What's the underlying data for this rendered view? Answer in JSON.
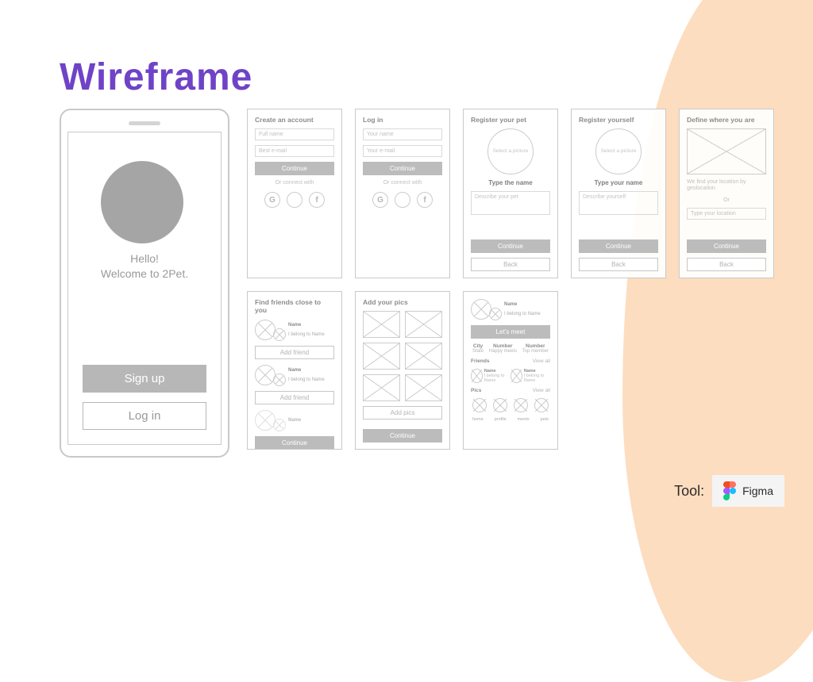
{
  "title": "Wireframe",
  "phone": {
    "hello": "Hello!",
    "welcome": "Welcome to 2Pet.",
    "signup": "Sign up",
    "login": "Log in"
  },
  "screens": {
    "create": {
      "head": "Create an account",
      "full_name": "Full name",
      "email": "Best e-mail",
      "continue": "Continue",
      "or": "Or connect with"
    },
    "login": {
      "head": "Log in",
      "name": "Your name",
      "email": "Your e-mail",
      "continue": "Continue",
      "or": "Or connect with"
    },
    "pet": {
      "head": "Register your pet",
      "select": "Select a picture",
      "type": "Type the name",
      "desc": "Describe your pet",
      "continue": "Continue",
      "back": "Back"
    },
    "yourself": {
      "head": "Register yourself",
      "select": "Select a picture",
      "type": "Type your name",
      "desc": "Describe yourself",
      "continue": "Continue",
      "back": "Back"
    },
    "where": {
      "head": "Define where you are",
      "note": "We find your location by geolocation",
      "or": "Or",
      "type_loc": "Type your location",
      "continue": "Continue",
      "back": "Back"
    },
    "friends": {
      "head": "Find friends close to you",
      "name": "Name",
      "belong": "I belong to Name",
      "add": "Add friend",
      "continue": "Continue"
    },
    "pics": {
      "head": "Add your pics",
      "add": "Add pics",
      "continue": "Continue"
    },
    "profile": {
      "name": "Name",
      "belong": "I belong to Name",
      "lets": "Let's meet",
      "stats": [
        {
          "h": "City",
          "s": "State"
        },
        {
          "h": "Number",
          "s": "Happy meets"
        },
        {
          "h": "Number",
          "s": "Top member"
        }
      ],
      "friends": "Friends",
      "pics": "Pics",
      "view_all": "View all",
      "f_name": "Name",
      "f_belong": "I belong to Name",
      "nav": [
        "home",
        "profile",
        "meets",
        "pets"
      ]
    }
  },
  "tool": {
    "label": "Tool:",
    "name": "Figma"
  }
}
